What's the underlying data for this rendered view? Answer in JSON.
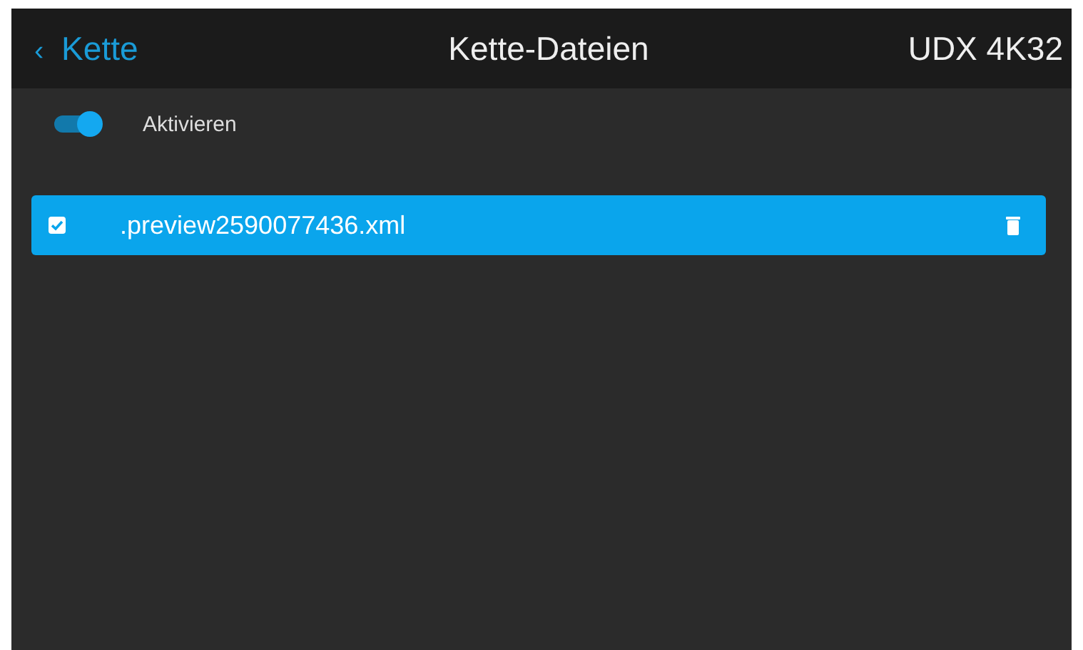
{
  "header": {
    "back_icon": "‹",
    "back_label": "Kette",
    "title": "Kette-Dateien",
    "device": "UDX 4K32"
  },
  "enable_toggle": {
    "label": "Aktivieren",
    "on": true
  },
  "files": [
    {
      "name": ".preview2590077436.xml",
      "checked": true,
      "selected": true
    }
  ]
}
